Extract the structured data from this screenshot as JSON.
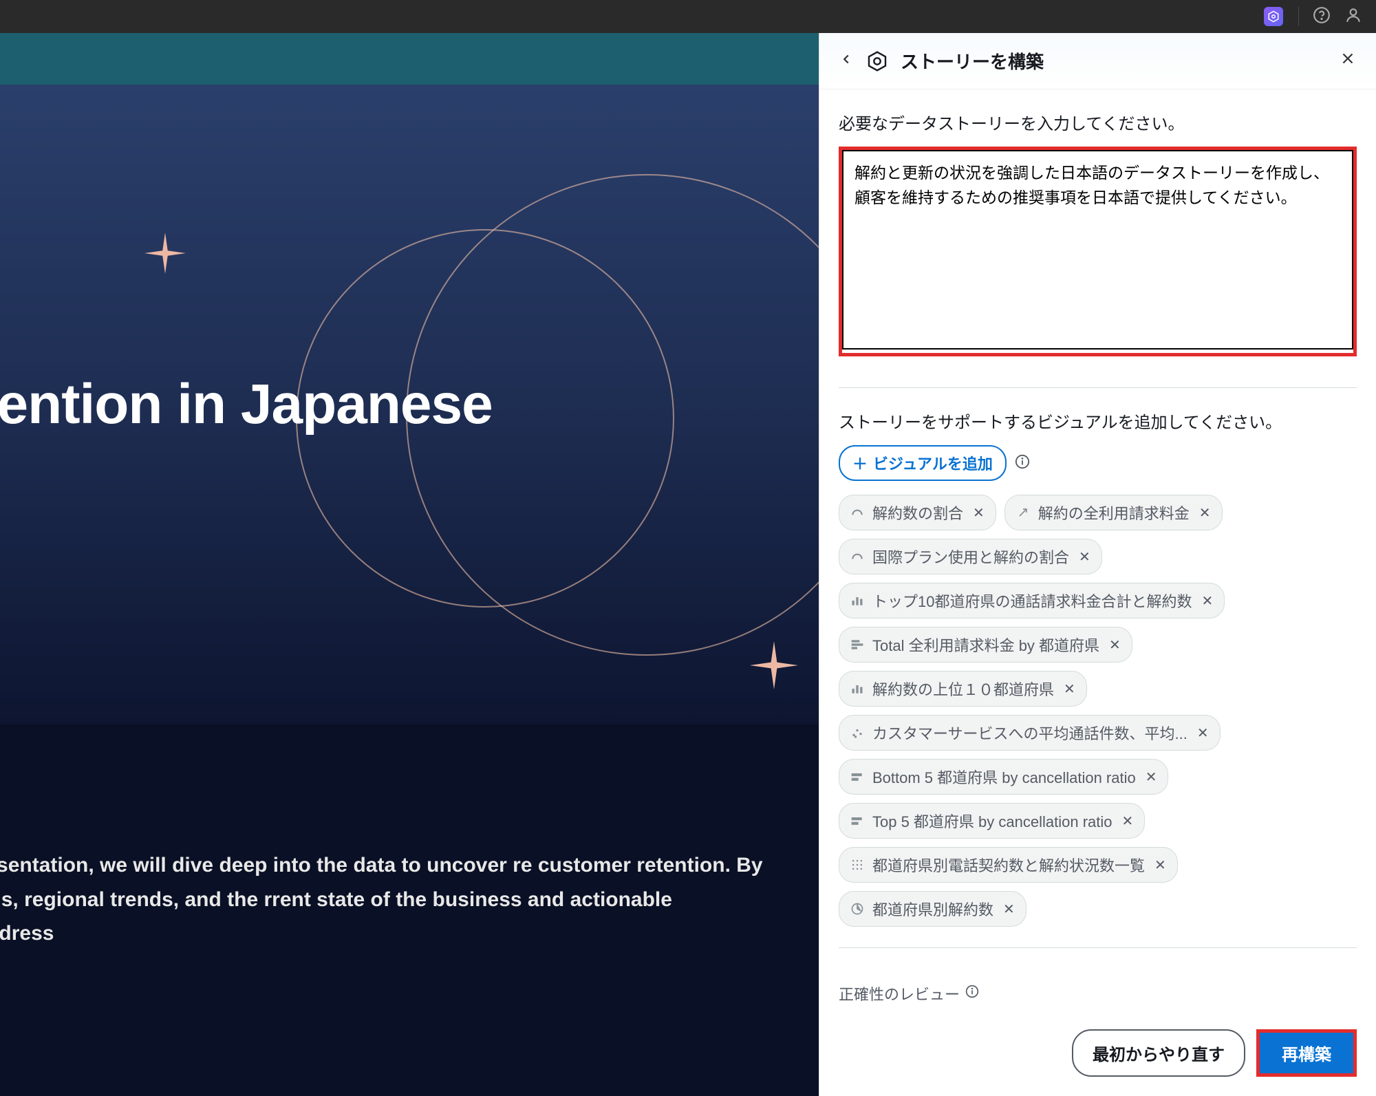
{
  "topbar": {},
  "panel": {
    "title": "ストーリーを構築",
    "prompt_label": "必要なデータストーリーを入力してください。",
    "story_input": "解約と更新の状況を強調した日本語のデータストーリーを作成し、顧客を維持するための推奨事項を日本語で提供してください。",
    "visuals_label": "ストーリーをサポートするビジュアルを追加してください。",
    "add_visual_label": "ビジュアルを追加",
    "chips": [
      {
        "icon": "gauge",
        "label": "解約数の割合"
      },
      {
        "icon": "arrow",
        "label": "解約の全利用請求料金"
      },
      {
        "icon": "gauge",
        "label": "国際プラン使用と解約の割合"
      },
      {
        "icon": "bar",
        "label": "トップ10都道府県の通話請求料金合計と解約数"
      },
      {
        "icon": "bar-h",
        "label": "Total 全利用請求料金 by 都道府県"
      },
      {
        "icon": "bar",
        "label": "解約数の上位１０都道府県"
      },
      {
        "icon": "scatter",
        "label": "カスタマーサービスへの平均通話件数、平均..."
      },
      {
        "icon": "bar-h2",
        "label": "Bottom 5 都道府県 by cancellation ratio"
      },
      {
        "icon": "bar-h2",
        "label": "Top 5 都道府県 by cancellation ratio"
      },
      {
        "icon": "grid",
        "label": "都道府県別電話契約数と解約状況数一覧"
      },
      {
        "icon": "pie",
        "label": "都道府県別解約数"
      }
    ],
    "review_label": "正確性のレビュー",
    "btn_restart": "最初からやり直す",
    "btn_rebuild": "再構築"
  },
  "hero": {
    "title": "ner Retention in Japanese",
    "body": "tomer churn. In this presentation, we will dive deep into the data to uncover re customer retention. By analyzing usage patterns, regional trends, and the rrent state of the business and actionable recommendations to address"
  }
}
